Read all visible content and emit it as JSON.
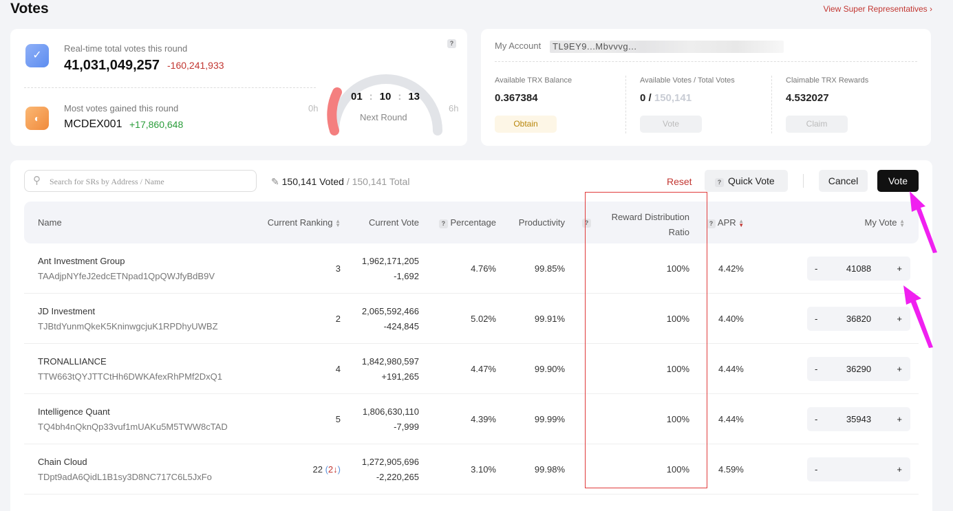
{
  "page": {
    "title": "Votes",
    "super_reps_link": "View Super Representatives ›"
  },
  "round": {
    "total_label": "Real-time total votes this round",
    "total_votes": "41,031,049,257",
    "total_change": "-160,241,933",
    "gained_label": "Most votes gained this round",
    "gained_name": "MCDEX001",
    "gained_change": "+17,860,648",
    "timer_h": "01",
    "timer_m": "10",
    "timer_s": "13",
    "sep": ":",
    "next_round": "Next Round",
    "start": "0h",
    "end": "6h",
    "help": "?",
    "progress": 0.2
  },
  "account": {
    "label": "My Account",
    "address": "TL9EY9...Mbvvvg...",
    "balance_label": "Available TRX Balance",
    "balance": "0.367384",
    "votes_label": "Available Votes / Total Votes",
    "votes_available": "0 /",
    "votes_total": "150,141",
    "rewards_label": "Claimable TRX Rewards",
    "rewards": "4.532027",
    "obtain": "Obtain",
    "vote": "Vote",
    "claim": "Claim"
  },
  "toolbar": {
    "search_placeholder": "Search for SRs by Address / Name",
    "voted": "150,141 Voted",
    "total": "/ 150,141 Total",
    "reset": "Reset",
    "quick_vote": "Quick Vote",
    "cancel": "Cancel",
    "vote": "Vote",
    "help": "?"
  },
  "table": {
    "headers": {
      "name": "Name",
      "ranking": "Current Ranking",
      "current_vote": "Current Vote",
      "percentage": "Percentage",
      "productivity": "Productivity",
      "reward": "Reward Distribution",
      "reward2": "Ratio",
      "apr": "APR",
      "my_vote": "My Vote"
    },
    "rows": [
      {
        "name": "Ant Investment Group",
        "address": "TAAdjpNYfeJ2edcETNpad1QpQWJfyBdB9V",
        "ranking": "3",
        "ranking_change": "",
        "vote": "1,962,171,205",
        "change": "-1,692",
        "positive": false,
        "percentage": "4.76%",
        "productivity": "99.85%",
        "reward": "100%",
        "apr": "4.42%",
        "my_vote": "41088"
      },
      {
        "name": "JD Investment",
        "address": "TJBtdYunmQkeK5KninwgcjuK1RPDhyUWBZ",
        "ranking": "2",
        "ranking_change": "",
        "vote": "2,065,592,466",
        "change": "-424,845",
        "positive": false,
        "percentage": "5.02%",
        "productivity": "99.91%",
        "reward": "100%",
        "apr": "4.40%",
        "my_vote": "36820"
      },
      {
        "name": "TRONALLIANCE",
        "address": "TTW663tQYJTTCtHh6DWKAfexRhPMf2DxQ1",
        "ranking": "4",
        "ranking_change": "",
        "vote": "1,842,980,597",
        "change": "+191,265",
        "positive": true,
        "percentage": "4.47%",
        "productivity": "99.90%",
        "reward": "100%",
        "apr": "4.44%",
        "my_vote": "36290"
      },
      {
        "name": "Intelligence Quant",
        "address": "TQ4bh4nQknQp33vuf1mUAKu5M5TWW8cTAD",
        "ranking": "5",
        "ranking_change": "",
        "vote": "1,806,630,110",
        "change": "-7,999",
        "positive": false,
        "percentage": "4.39%",
        "productivity": "99.99%",
        "reward": "100%",
        "apr": "4.44%",
        "my_vote": "35943"
      },
      {
        "name": "Chain Cloud",
        "address": "TDpt9adA6QidL1B1sy3D8NC717C6L5JxFo",
        "ranking": "22",
        "ranking_change": "2↓",
        "vote": "1,272,905,696",
        "change": "-2,220,265",
        "positive": false,
        "percentage": "3.10%",
        "productivity": "99.98%",
        "reward": "100%",
        "apr": "4.59%",
        "my_vote": ""
      }
    ]
  },
  "stepper": {
    "minus": "-",
    "plus": "+"
  }
}
